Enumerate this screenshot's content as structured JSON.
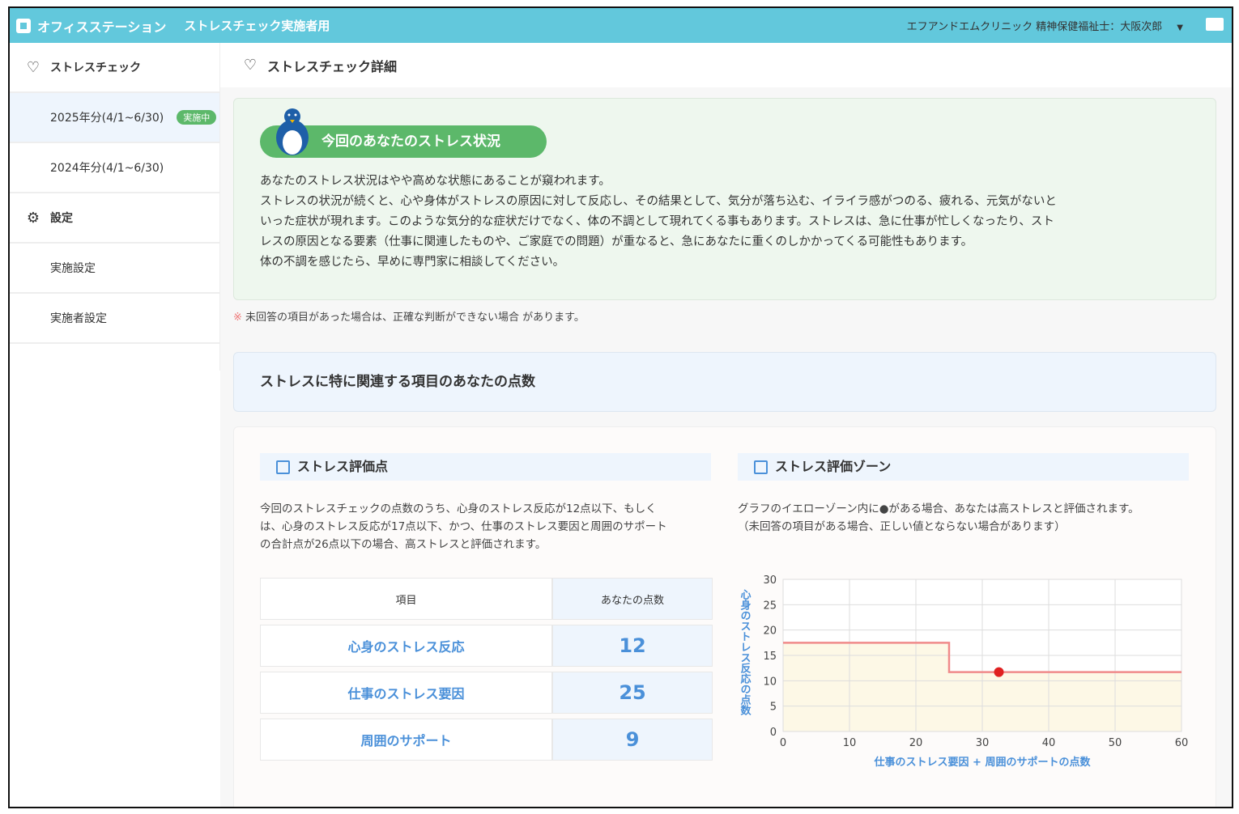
{
  "header": {
    "app_name": "オフィスステーション",
    "subtitle": "ストレスチェック実施者用",
    "user": "エフアンドエムクリニック 精神保健福祉士：大阪次郎"
  },
  "sidebar": {
    "section1": "ストレスチェック",
    "items": [
      {
        "label": "2025年分(4/1~6/30)",
        "badge": "実施中"
      },
      {
        "label": "2024年分(4/1~6/30)"
      }
    ],
    "section2": "設定",
    "settings": [
      "実施設定",
      "実施者設定"
    ]
  },
  "main": {
    "title": "ストレスチェック詳細",
    "status": {
      "heading": "今回のあなたのストレス状況",
      "lines": [
        "あなたのストレス状況はやや高めな状態にあることが窺われます。",
        "ストレスの状況が続くと、心や身体がストレスの原因に対して反応し、その結果として、気分が落ち込む、イライラ感がつのる、疲れる、元気がないと",
        "いった症状が現れます。このような気分的な症状だけでなく、体の不調として現れてくる事もあります。ストレスは、急に仕事が忙しくなったり、スト",
        "レスの原因となる要素（仕事に関連したものや、ご家庭での問題）が重なると、急にあなたに重くのしかかってくる可能性もあります。",
        "体の不調を感じたら、早めに専門家に相談してください。"
      ]
    },
    "note_mark": "※",
    "note": "未回答の項目があった場合は、正確な判断ができない場合 があります。",
    "section_title": "ストレスに特に関連する項目のあなたの点数",
    "score": {
      "title": "ストレス評価点",
      "desc": [
        "今回のストレスチェックの点数のうち、心身のストレス反応が12点以下、もしく",
        "は、心身のストレス反応が17点以下、かつ、仕事のストレス要因と周囲のサポート",
        "の合計点が26点以下の場合、高ストレスと評価されます。"
      ],
      "col_item": "項目",
      "col_score": "あなたの点数",
      "rows": [
        {
          "label": "心身のストレス反応",
          "value": "12"
        },
        {
          "label": "仕事のストレス要因",
          "value": "25"
        },
        {
          "label": "周囲のサポート",
          "value": "9"
        }
      ]
    },
    "zone": {
      "title": "ストレス評価ゾーン",
      "desc": [
        "グラフのイエローゾーン内に●がある場合、あなたは高ストレスと評価されます。",
        "（未回答の項目がある場合、正しい値とならない場合があります）"
      ]
    }
  },
  "chart_data": {
    "type": "line",
    "xlabel": "仕事のストレス要因 + 周囲のサポートの点数",
    "ylabel": "心身のストレス反応の点数",
    "xlim": [
      0,
      60
    ],
    "ylim": [
      0,
      30
    ],
    "xticks": [
      "0",
      "10",
      "20",
      "30",
      "40",
      "50",
      "60"
    ],
    "yticks": [
      "0",
      "5",
      "10",
      "15",
      "20",
      "25",
      "30"
    ],
    "grid": true,
    "threshold": [
      [
        0,
        17.5
      ],
      [
        25,
        17.5
      ],
      [
        25,
        11.7
      ],
      [
        60,
        11.7
      ]
    ],
    "point": {
      "x": 32.5,
      "y": 11.7
    },
    "zone_color": "#fdf8e6",
    "line_color": "#f08a8a",
    "point_color": "#e02020"
  }
}
